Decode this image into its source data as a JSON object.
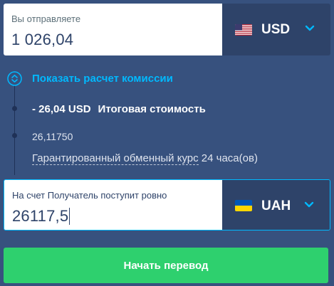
{
  "send": {
    "label": "Вы отправляете",
    "amount": "1 026,04",
    "currency": "USD",
    "flag_icon": "us-flag-icon"
  },
  "fee_toggle": {
    "label": "Показать расчет комиссии"
  },
  "fee": {
    "amount": "- 26,04 USD",
    "label": "Итоговая стоимость"
  },
  "rate": {
    "value": "26,11750",
    "link_text": "Гарантированный обменный курс",
    "suffix": " 24 часа(ов)"
  },
  "receive": {
    "label": "На счет Получатель поступит ровно",
    "amount": "26117,5",
    "currency": "UAH",
    "flag_icon": "ua-flag-icon"
  },
  "submit_label": "Начать перевод",
  "colors": {
    "background": "#37517e",
    "accent": "#00b9ff",
    "button": "#2ed06e",
    "select_bg": "#2e4369"
  }
}
